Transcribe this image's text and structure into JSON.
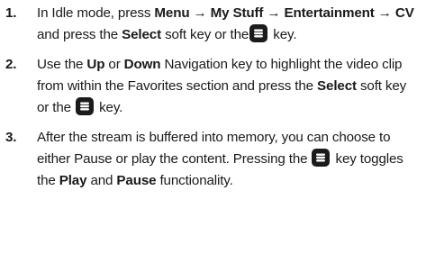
{
  "steps": [
    {
      "number": "1.",
      "segments": [
        {
          "text": "In Idle mode, press ",
          "bold": false
        },
        {
          "text": "Menu",
          "bold": true
        },
        {
          "text": " → ",
          "bold": true
        },
        {
          "text": "My Stuff",
          "bold": true
        },
        {
          "text": " → ",
          "bold": true
        },
        {
          "text": "Entertainment",
          "bold": true
        },
        {
          "text": " → ",
          "bold": true
        },
        {
          "text": "CV",
          "bold": true
        },
        {
          "text": " and press the ",
          "bold": false
        },
        {
          "text": "Select",
          "bold": true
        },
        {
          "text": " soft key or the",
          "bold": false
        },
        {
          "icon": "select-key-icon"
        },
        {
          "text": " key.",
          "bold": false
        }
      ]
    },
    {
      "number": "2.",
      "segments": [
        {
          "text": "Use the ",
          "bold": false
        },
        {
          "text": "Up",
          "bold": true
        },
        {
          "text": " or ",
          "bold": false
        },
        {
          "text": "Down",
          "bold": true
        },
        {
          "text": " Navigation key to highlight the video clip from within the Favorites section and press the ",
          "bold": false
        },
        {
          "text": "Select",
          "bold": true
        },
        {
          "text": " soft key or the ",
          "bold": false
        },
        {
          "icon": "select-key-icon"
        },
        {
          "text": " key.",
          "bold": false
        }
      ]
    },
    {
      "number": "3.",
      "segments": [
        {
          "text": "After the stream is buffered into memory, you can choose to either Pause or play the content. Pressing the ",
          "bold": false
        },
        {
          "icon": "select-key-icon"
        },
        {
          "text": " key toggles the ",
          "bold": false
        },
        {
          "text": "Play",
          "bold": true
        },
        {
          "text": " and ",
          "bold": false
        },
        {
          "text": "Pause",
          "bold": true
        },
        {
          "text": " functionality.",
          "bold": false
        }
      ]
    }
  ]
}
